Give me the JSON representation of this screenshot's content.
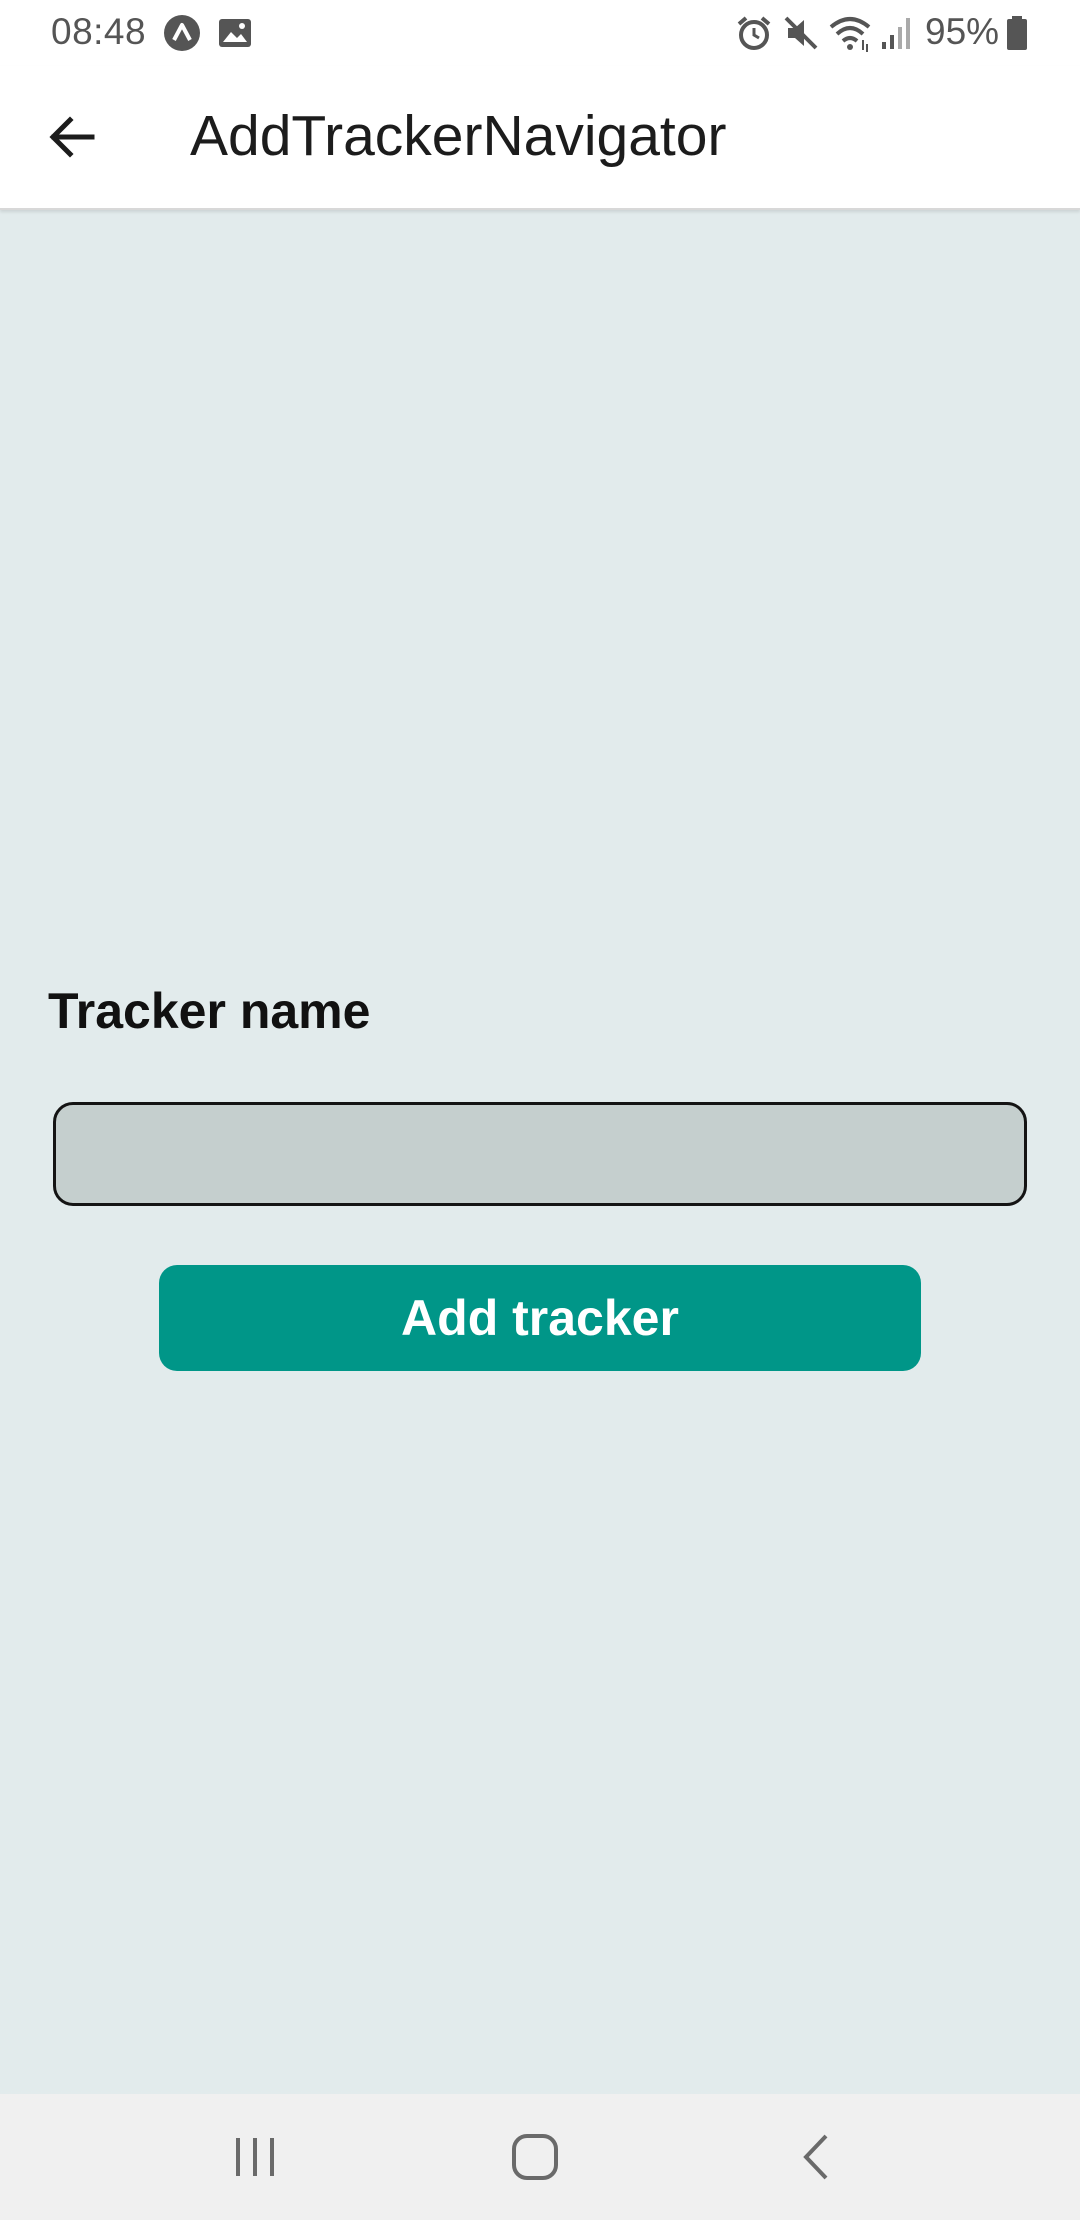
{
  "status_bar": {
    "time": "08:48",
    "battery": "95%",
    "left_icons": [
      "app-notification-icon",
      "image-icon"
    ],
    "right_icons": [
      "alarm-icon",
      "mute-icon",
      "wifi-icon",
      "signal-icon",
      "battery-icon"
    ]
  },
  "app_bar": {
    "title": "AddTrackerNavigator",
    "back_icon": "arrow-left-icon"
  },
  "form": {
    "label": "Tracker name",
    "input_value": "",
    "button_label": "Add tracker"
  },
  "nav_bar": {
    "icons": [
      "recent-apps-icon",
      "home-icon",
      "back-icon"
    ]
  },
  "colors": {
    "background": "#e2ebec",
    "accent": "#009688",
    "input_fill": "#c5cfce"
  }
}
